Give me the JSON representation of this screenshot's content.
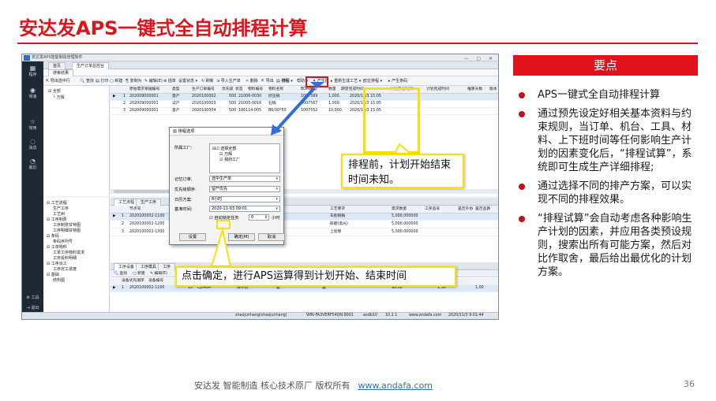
{
  "slide": {
    "title": "安达发APS一键式全自动排程计算",
    "key_header": "要点",
    "bullets": [
      "APS一键式全自动排程计算",
      "通过预先设定好相关基本资料与约束规则，当订单、机台、工具、材料、上下班时间等任何影响生产计划的因素变化后，“排程试算”，系统即可生成生产详细排程;",
      "通过选择不同的排产方案，可以实现不同的排程效果。",
      "“排程试算”会自动考虑各种影响生产计划的因素，并应用各类预设规则，搜索出所有可能方案，然后对比作取舍，最后给出最优化的计划方案。"
    ],
    "callout_before": "排程前，计划开始结束时间未知。",
    "callout_after": "点击确定，进行APS运算得到计划开始、结束时间",
    "footer_text": "安达发  智能制造 核心技术原厂  版权所有",
    "footer_link": "www.andafa.com",
    "page_number": "36",
    "colors": {
      "accent": "#e0121b",
      "highlight": "#f7e200"
    }
  },
  "app": {
    "window_title": "安达发APS智能制造管理软件",
    "tabs": [
      "首页",
      "生产订单总控台"
    ],
    "subtab": "搜索结果",
    "left_nav": [
      {
        "icon": "grid-icon",
        "label": "程序"
      },
      {
        "icon": "clock-icon",
        "label": "常速"
      },
      {
        "icon": "star-icon",
        "label": "常用"
      },
      {
        "icon": "chat-icon",
        "label": "消息"
      },
      {
        "icon": "history-icon",
        "label": "最近"
      },
      {
        "icon": "gear-icon",
        "label": "工具"
      },
      {
        "icon": "exit-icon",
        "label": "退出"
      }
    ],
    "toolbar": [
      "导出选中行",
      "查找",
      "打印",
      "新建",
      "复制为",
      "编辑(E)",
      "插单",
      "设置状态",
      "刷新",
      "导入生产单",
      "删除",
      "导出",
      "排程",
      "帮助",
      "产生批",
      "重新生成工艺",
      "欧拉排程",
      "产生条码"
    ],
    "tree1": [
      "全部",
      "万辉"
    ],
    "grid1": {
      "columns": [
        "原始需求单据编号",
        "类型",
        "生产订单编号",
        "优先级",
        "状态",
        "物料编号",
        "物料名称",
        "BOM编号",
        "数量",
        "期望完成时间",
        "计划开始时间",
        "计划完成时间",
        "推算天数",
        "版本"
      ],
      "rows": [
        [
          "1",
          "202009000001",
          "量产",
          "2020100002",
          "500",
          "21006-0030",
          "挤压锅",
          "1007569",
          "1,000.",
          "2020/11/3 15:05"
        ],
        [
          "2",
          "202009000001",
          "试产",
          "2020100003",
          "500",
          "21005-0016",
          "石锅",
          "1007567",
          "1,000.",
          "2020/11/3 15:05"
        ],
        [
          "3",
          "202009000001",
          "量产",
          "2020100004",
          "500",
          "106114-005",
          "B6/30*50",
          "1007552",
          "10,000.",
          "2020/11/3 15:05"
        ]
      ]
    },
    "tree2": [
      "工艺流程",
      "生产工序",
      "工艺树",
      "工序制费",
      "工序制费甘特图",
      "工序明细甘特图",
      "条码",
      "条码序列号",
      "工单物料",
      "工单工序物料需求",
      "工序投料明细",
      "工序派工",
      "工序完工进度",
      "基础",
      "结构图"
    ],
    "panel2_tabs": [
      "工艺流程",
      "生产工序"
    ],
    "grid2": {
      "columns": [
        "节点号",
        "工序名称",
        "工艺要求",
        "需求数量",
        "工序品号",
        "是否外协",
        "是否品质"
      ],
      "rows": [
        [
          "1",
          "2020100002-1100",
          "车削",
          "车削锅锅",
          "5,000.000000"
        ],
        [
          "2",
          "2020100002-1200",
          "冲压",
          "研磨(黑光)",
          "5,000.000000"
        ],
        [
          "3",
          "2020100002-1300",
          "检验",
          "上劲架",
          "5,000.000000"
        ]
      ]
    },
    "panel3_tabs": [
      "工序设备",
      "工序模具",
      "工序"
    ],
    "grid3": {
      "columns": [
        "设备优先顺序",
        "设备编号",
        "设备名称",
        "是否启用"
      ],
      "rows": [
        [
          "1",
          "2020100002-1100",
          "10",
          "CJ0464",
          "弹子机",
          "是",
          "是",
          "90.00",
          "1.50",
          "1.00"
        ]
      ]
    },
    "status": [
      "shaojunhang(shaojunhang)",
      "WIN-FA3VERF54QN:9001",
      "axdb10",
      "10.2.1",
      "www.andafa.com",
      "2020/11/3 9:01:44"
    ],
    "dialog": {
      "title": "排程选项",
      "factory_label": "所属工厂:",
      "factory_items": [
        "选择全部",
        "万辉",
        "我的工厂"
      ],
      "order_label": "记忆订单:",
      "order_value": "选中生产单",
      "priority_label": "优先级顺序:",
      "priority_value": "留产优先",
      "calendar_label": "日历方案:",
      "calendar_value": "8小时",
      "basetime_label": "基准时间:",
      "basetime_value": "2020-11-03 09:01",
      "lock_label": "自动锁定任务",
      "lock_value": "0",
      "lock_unit": "小时",
      "btn_settings": "设置",
      "btn_ok": "确定(M)",
      "btn_cancel": "取消"
    }
  }
}
